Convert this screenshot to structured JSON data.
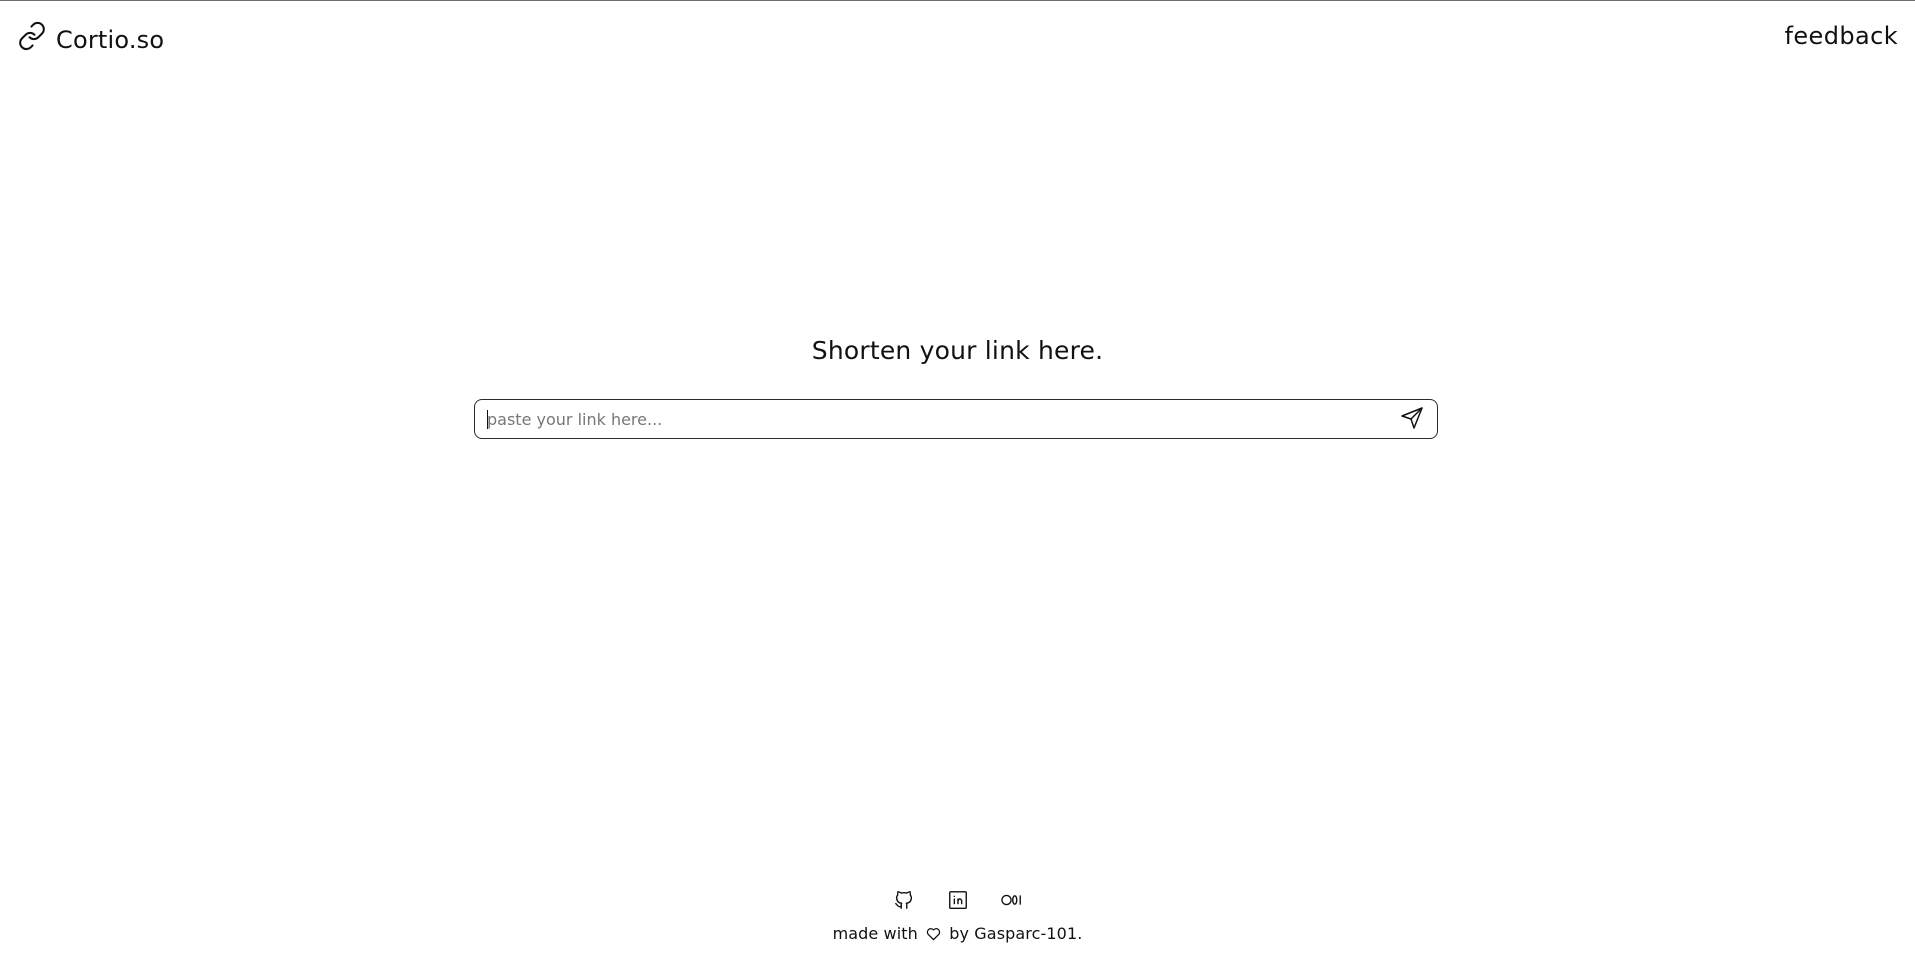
{
  "header": {
    "brand_name": "Cortio.so",
    "brand_icon": "link-icon",
    "feedback_label": "feedback"
  },
  "main": {
    "headline": "Shorten your link here.",
    "url_input": {
      "placeholder": "paste your link here...",
      "value": ""
    },
    "send_icon": "send-icon"
  },
  "footer": {
    "socials": [
      {
        "name": "github",
        "icon": "github-icon"
      },
      {
        "name": "linkedin",
        "icon": "linkedin-icon"
      },
      {
        "name": "medium",
        "icon": "medium-icon"
      }
    ],
    "credit_prefix": "made with",
    "credit_suffix": "by Gasparc-101.",
    "heart_icon": "heart-icon"
  },
  "colors": {
    "text": "#111111",
    "placeholder": "#777777",
    "border": "#2b2b2b",
    "background": "#ffffff"
  }
}
